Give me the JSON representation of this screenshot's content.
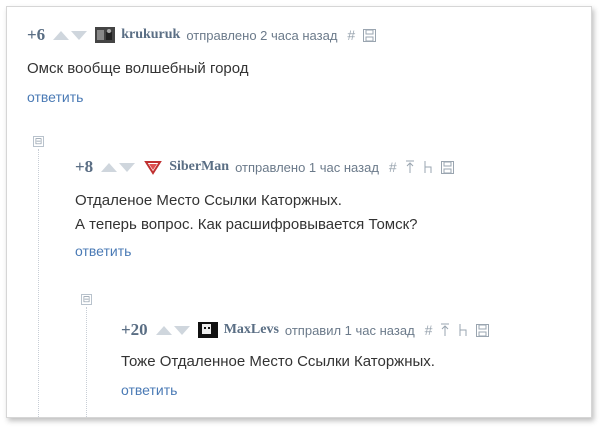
{
  "comments": [
    {
      "rating": "+6",
      "username": "krukuruk",
      "meta": "отправлено 2 часа назад",
      "lines": [
        "Омск вообще волшебный город"
      ],
      "reply_label": "ответить"
    },
    {
      "rating": "+8",
      "username": "SiberMan",
      "meta": "отправлено 1 час назад",
      "lines": [
        "Отдаленое Место Ссылки Каторжных.",
        "А теперь вопрос. Как расшифровывается Томск?"
      ],
      "reply_label": "ответить"
    },
    {
      "rating": "+20",
      "username": "MaxLevs",
      "meta": "отправил 1 час назад",
      "lines": [
        "Тоже Отдаленное Место Ссылки Каторжных."
      ],
      "reply_label": "ответить"
    }
  ],
  "tool_symbols": {
    "hash": "#",
    "collapse": "⊟"
  },
  "colors": {
    "rating": "#5a6e84",
    "link": "#4a7ab5",
    "meta": "#6b7a8a",
    "vote_arrow": "#cfd6dd"
  }
}
